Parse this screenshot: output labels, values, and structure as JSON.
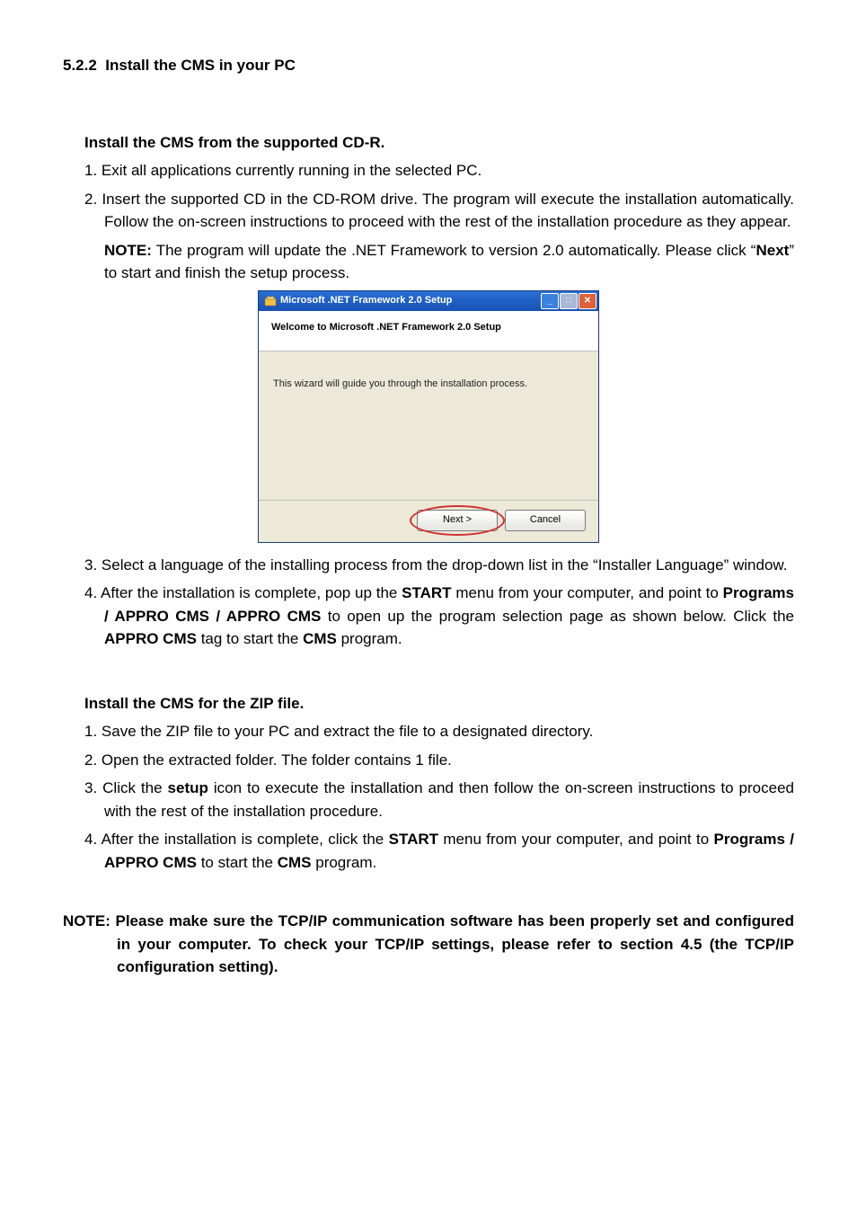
{
  "doc": {
    "section_number": "5.2.2",
    "section_title": "Install the CMS in your PC",
    "cd_heading": "Install the CMS from the supported CD-R.",
    "cd_step1": "1. Exit all applications currently running in the selected PC.",
    "cd_step2": "2. Insert the supported CD in the CD-ROM drive. The program will execute the installation automatically. Follow the on-screen instructions to proceed with the rest of the installation procedure as they appear.",
    "note_label": "NOTE:",
    "note_text_a": " The program will update the .NET Framework to version 2.0 automatically. Please click “",
    "note_bold": "Next",
    "note_text_b": "” to start and finish the setup process.",
    "cd_step3": "3. Select a language of the installing process from the drop-down list in the “Installer Language” window.",
    "cd_step4_a": "4. After the installation is complete, pop up the ",
    "cd_step4_start": "START",
    "cd_step4_b": " menu from your computer, and point to ",
    "cd_step4_path": "Programs / APPRO CMS / APPRO CMS",
    "cd_step4_c": " to open up the program selection page as shown below. Click the ",
    "cd_step4_tag": "APPRO CMS",
    "cd_step4_d": " tag to start the ",
    "cd_step4_prog": "CMS",
    "cd_step4_e": " program.",
    "zip_heading": "Install the CMS for the ZIP file.",
    "zip_step1": "1. Save the ZIP file to your PC and extract the file to a designated directory.",
    "zip_step2": "2. Open the extracted folder. The folder contains 1 file.",
    "zip_step3_a": "3. Click the ",
    "zip_step3_setup": "setup",
    "zip_step3_b": " icon to execute the installation and then follow the on-screen instructions to proceed with the rest of the installation procedure.",
    "zip_step4_a": "4. After the installation is complete, click the ",
    "zip_step4_start": "START",
    "zip_step4_b": " menu from your computer, and point to ",
    "zip_step4_path": "Programs / APPRO CMS",
    "zip_step4_c": " to start the ",
    "zip_step4_prog": "CMS",
    "zip_step4_d": " program.",
    "final_note": "NOTE: Please make sure the TCP/IP communication software has been properly set and configured in your computer. To check your TCP/IP settings, please refer to section 4.5 (the TCP/IP configuration setting)."
  },
  "dialog": {
    "title": "Microsoft .NET Framework 2.0 Setup",
    "header": "Welcome to Microsoft .NET Framework 2.0 Setup",
    "body": "This wizard will guide you through the installation process.",
    "next": "Next >",
    "cancel": "Cancel"
  }
}
